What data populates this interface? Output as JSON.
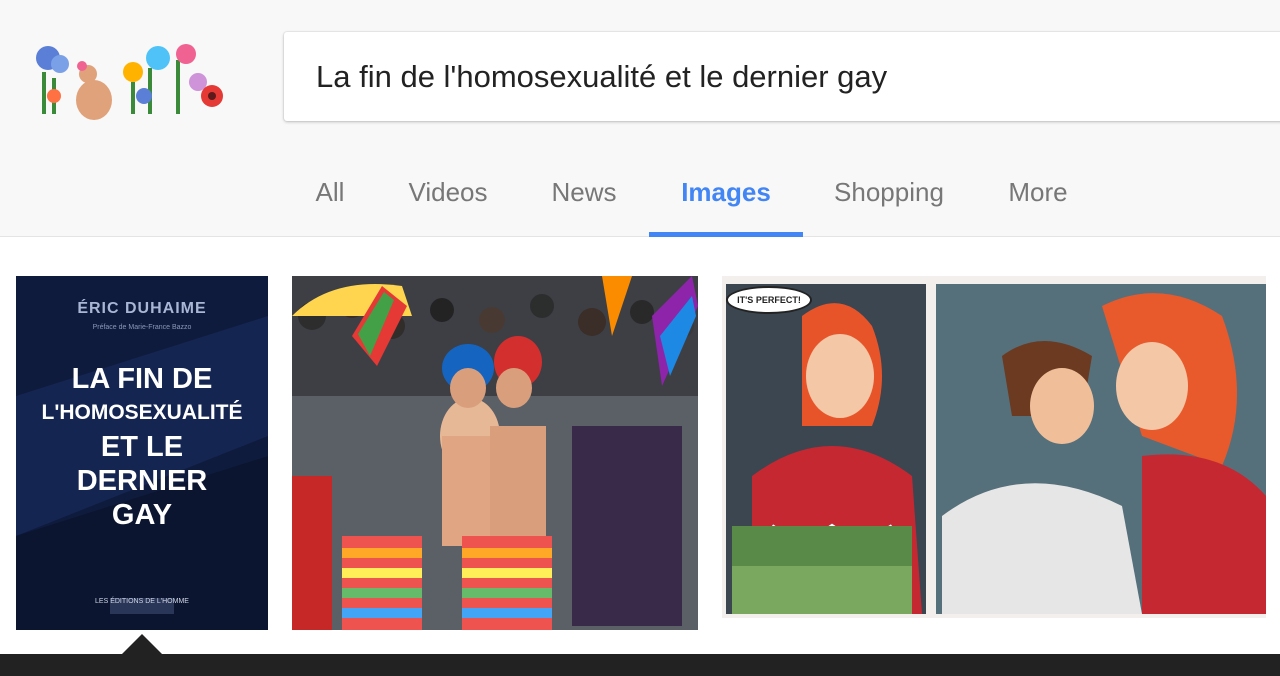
{
  "search": {
    "query": "La fin de l'homosexualité et le dernier gay"
  },
  "tabs": [
    {
      "label": "All"
    },
    {
      "label": "Videos"
    },
    {
      "label": "News"
    },
    {
      "label": "Images"
    },
    {
      "label": "Shopping"
    },
    {
      "label": "More"
    }
  ],
  "active_tab": "Images",
  "results": {
    "book": {
      "author": "ÉRIC DUHAIME",
      "preface": "Préface de Marie-France Bazzo",
      "title_line1": "LA FIN DE",
      "title_line2": "L'HOMOSEXUALITÉ",
      "title_line3": "ET LE",
      "title_line4": "DERNIER",
      "title_line5": "GAY",
      "publisher": "LES ÉDITIONS DE L'HOMME"
    },
    "comic": {
      "speech": "IT'S PERFECT!"
    }
  },
  "colors": {
    "accent": "#4285f4",
    "header_bg": "#f8f8f8",
    "tab_text": "#777777"
  },
  "icons": {
    "logo": "flowers-doodle-logo"
  }
}
